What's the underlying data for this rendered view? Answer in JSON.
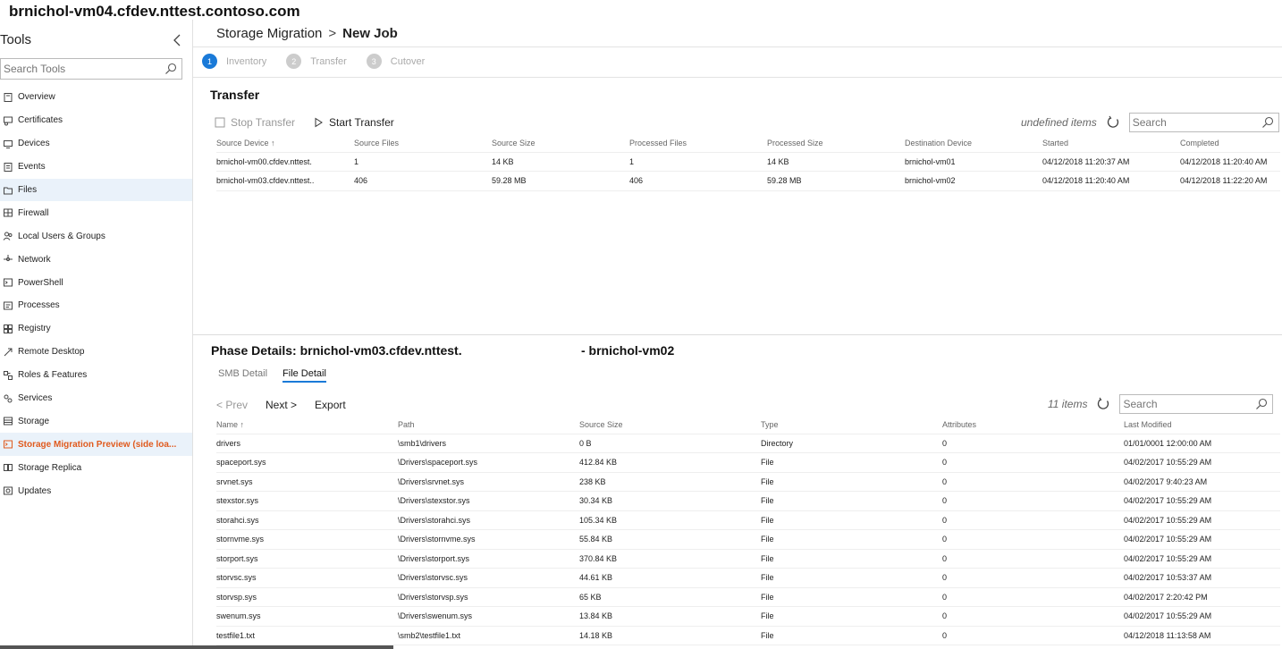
{
  "window": {
    "title": "brnichol-vm04.cfdev.nttest.contoso.com"
  },
  "sidebar": {
    "title": "Tools",
    "search_placeholder": "Search Tools",
    "items": [
      {
        "label": "Overview",
        "icon": "overview-icon"
      },
      {
        "label": "Certificates",
        "icon": "certificates-icon"
      },
      {
        "label": "Devices",
        "icon": "devices-icon"
      },
      {
        "label": "Events",
        "icon": "events-icon"
      },
      {
        "label": "Files",
        "icon": "files-icon"
      },
      {
        "label": "Firewall",
        "icon": "firewall-icon"
      },
      {
        "label": "Local Users & Groups",
        "icon": "users-icon"
      },
      {
        "label": "Network",
        "icon": "network-icon"
      },
      {
        "label": "PowerShell",
        "icon": "powershell-icon"
      },
      {
        "label": "Processes",
        "icon": "processes-icon"
      },
      {
        "label": "Registry",
        "icon": "registry-icon"
      },
      {
        "label": "Remote Desktop",
        "icon": "remote-desktop-icon"
      },
      {
        "label": "Roles & Features",
        "icon": "roles-icon"
      },
      {
        "label": "Services",
        "icon": "services-icon"
      },
      {
        "label": "Storage",
        "icon": "storage-icon"
      },
      {
        "label": "Storage Migration Preview (side loa...",
        "icon": "storage-migration-icon"
      },
      {
        "label": "Storage Replica",
        "icon": "storage-replica-icon"
      },
      {
        "label": "Updates",
        "icon": "updates-icon"
      }
    ]
  },
  "breadcrumb": {
    "parent": "Storage Migration",
    "separator": ">",
    "current": "New Job"
  },
  "steps": [
    {
      "num": "1",
      "label": "Inventory"
    },
    {
      "num": "2",
      "label": "Transfer"
    },
    {
      "num": "3",
      "label": "Cutover"
    }
  ],
  "transfer": {
    "title": "Transfer",
    "stop_label": "Stop Transfer",
    "start_label": "Start Transfer",
    "count_label": "undefined items",
    "search_placeholder": "Search",
    "columns": [
      "Source Device ↑",
      "Source Files",
      "Source Size",
      "Processed Files",
      "Processed Size",
      "Destination Device",
      "Started",
      "Completed"
    ],
    "rows": [
      [
        "brnichol-vm00.cfdev.nttest.",
        "1",
        "14 KB",
        "1",
        "14 KB",
        "brnichol-vm01",
        "04/12/2018 11:20:37 AM",
        "04/12/2018 11:20:40 AM"
      ],
      [
        "brnichol-vm03.cfdev.nttest..",
        "406",
        "59.28 MB",
        "406",
        "59.28 MB",
        "brnichol-vm02",
        "04/12/2018 11:20:40 AM",
        "04/12/2018 11:22:20 AM"
      ]
    ]
  },
  "phase": {
    "title": "Phase Details: brnichol-vm03.cfdev.nttest.",
    "title_dest": "- brnichol-vm02",
    "tabs": [
      "SMB Detail",
      "File Detail"
    ],
    "prev_label": "< Prev",
    "next_label": "Next >",
    "export_label": "Export",
    "count_label": "11 items",
    "search_placeholder": "Search",
    "columns": [
      "Name ↑",
      "Path",
      "Source Size",
      "Type",
      "Attributes",
      "Last Modified"
    ],
    "rows": [
      [
        "drivers",
        "\\smb1\\drivers",
        "0 B",
        "Directory",
        "0",
        "01/01/0001 12:00:00 AM"
      ],
      [
        "spaceport.sys",
        "\\Drivers\\spaceport.sys",
        "412.84 KB",
        "File",
        "0",
        "04/02/2017 10:55:29 AM"
      ],
      [
        "srvnet.sys",
        "\\Drivers\\srvnet.sys",
        "238 KB",
        "File",
        "0",
        "04/02/2017 9:40:23 AM"
      ],
      [
        "stexstor.sys",
        "\\Drivers\\stexstor.sys",
        "30.34 KB",
        "File",
        "0",
        "04/02/2017 10:55:29 AM"
      ],
      [
        "storahci.sys",
        "\\Drivers\\storahci.sys",
        "105.34 KB",
        "File",
        "0",
        "04/02/2017 10:55:29 AM"
      ],
      [
        "stornvme.sys",
        "\\Drivers\\stornvme.sys",
        "55.84 KB",
        "File",
        "0",
        "04/02/2017 10:55:29 AM"
      ],
      [
        "storport.sys",
        "\\Drivers\\storport.sys",
        "370.84 KB",
        "File",
        "0",
        "04/02/2017 10:55:29 AM"
      ],
      [
        "storvsc.sys",
        "\\Drivers\\storvsc.sys",
        "44.61 KB",
        "File",
        "0",
        "04/02/2017 10:53:37 AM"
      ],
      [
        "storvsp.sys",
        "\\Drivers\\storvsp.sys",
        "65 KB",
        "File",
        "0",
        "04/02/2017 2:20:42 PM"
      ],
      [
        "swenum.sys",
        "\\Drivers\\swenum.sys",
        "13.84 KB",
        "File",
        "0",
        "04/02/2017 10:55:29 AM"
      ],
      [
        "testfile1.txt",
        "\\smb2\\testfile1.txt",
        "14.18 KB",
        "File",
        "0",
        "04/12/2018 11:13:58 AM"
      ]
    ]
  },
  "colors": {
    "accent": "#1a7ad8",
    "active_tool": "#e05a1e",
    "selected_bg": "#eaf2fa"
  }
}
